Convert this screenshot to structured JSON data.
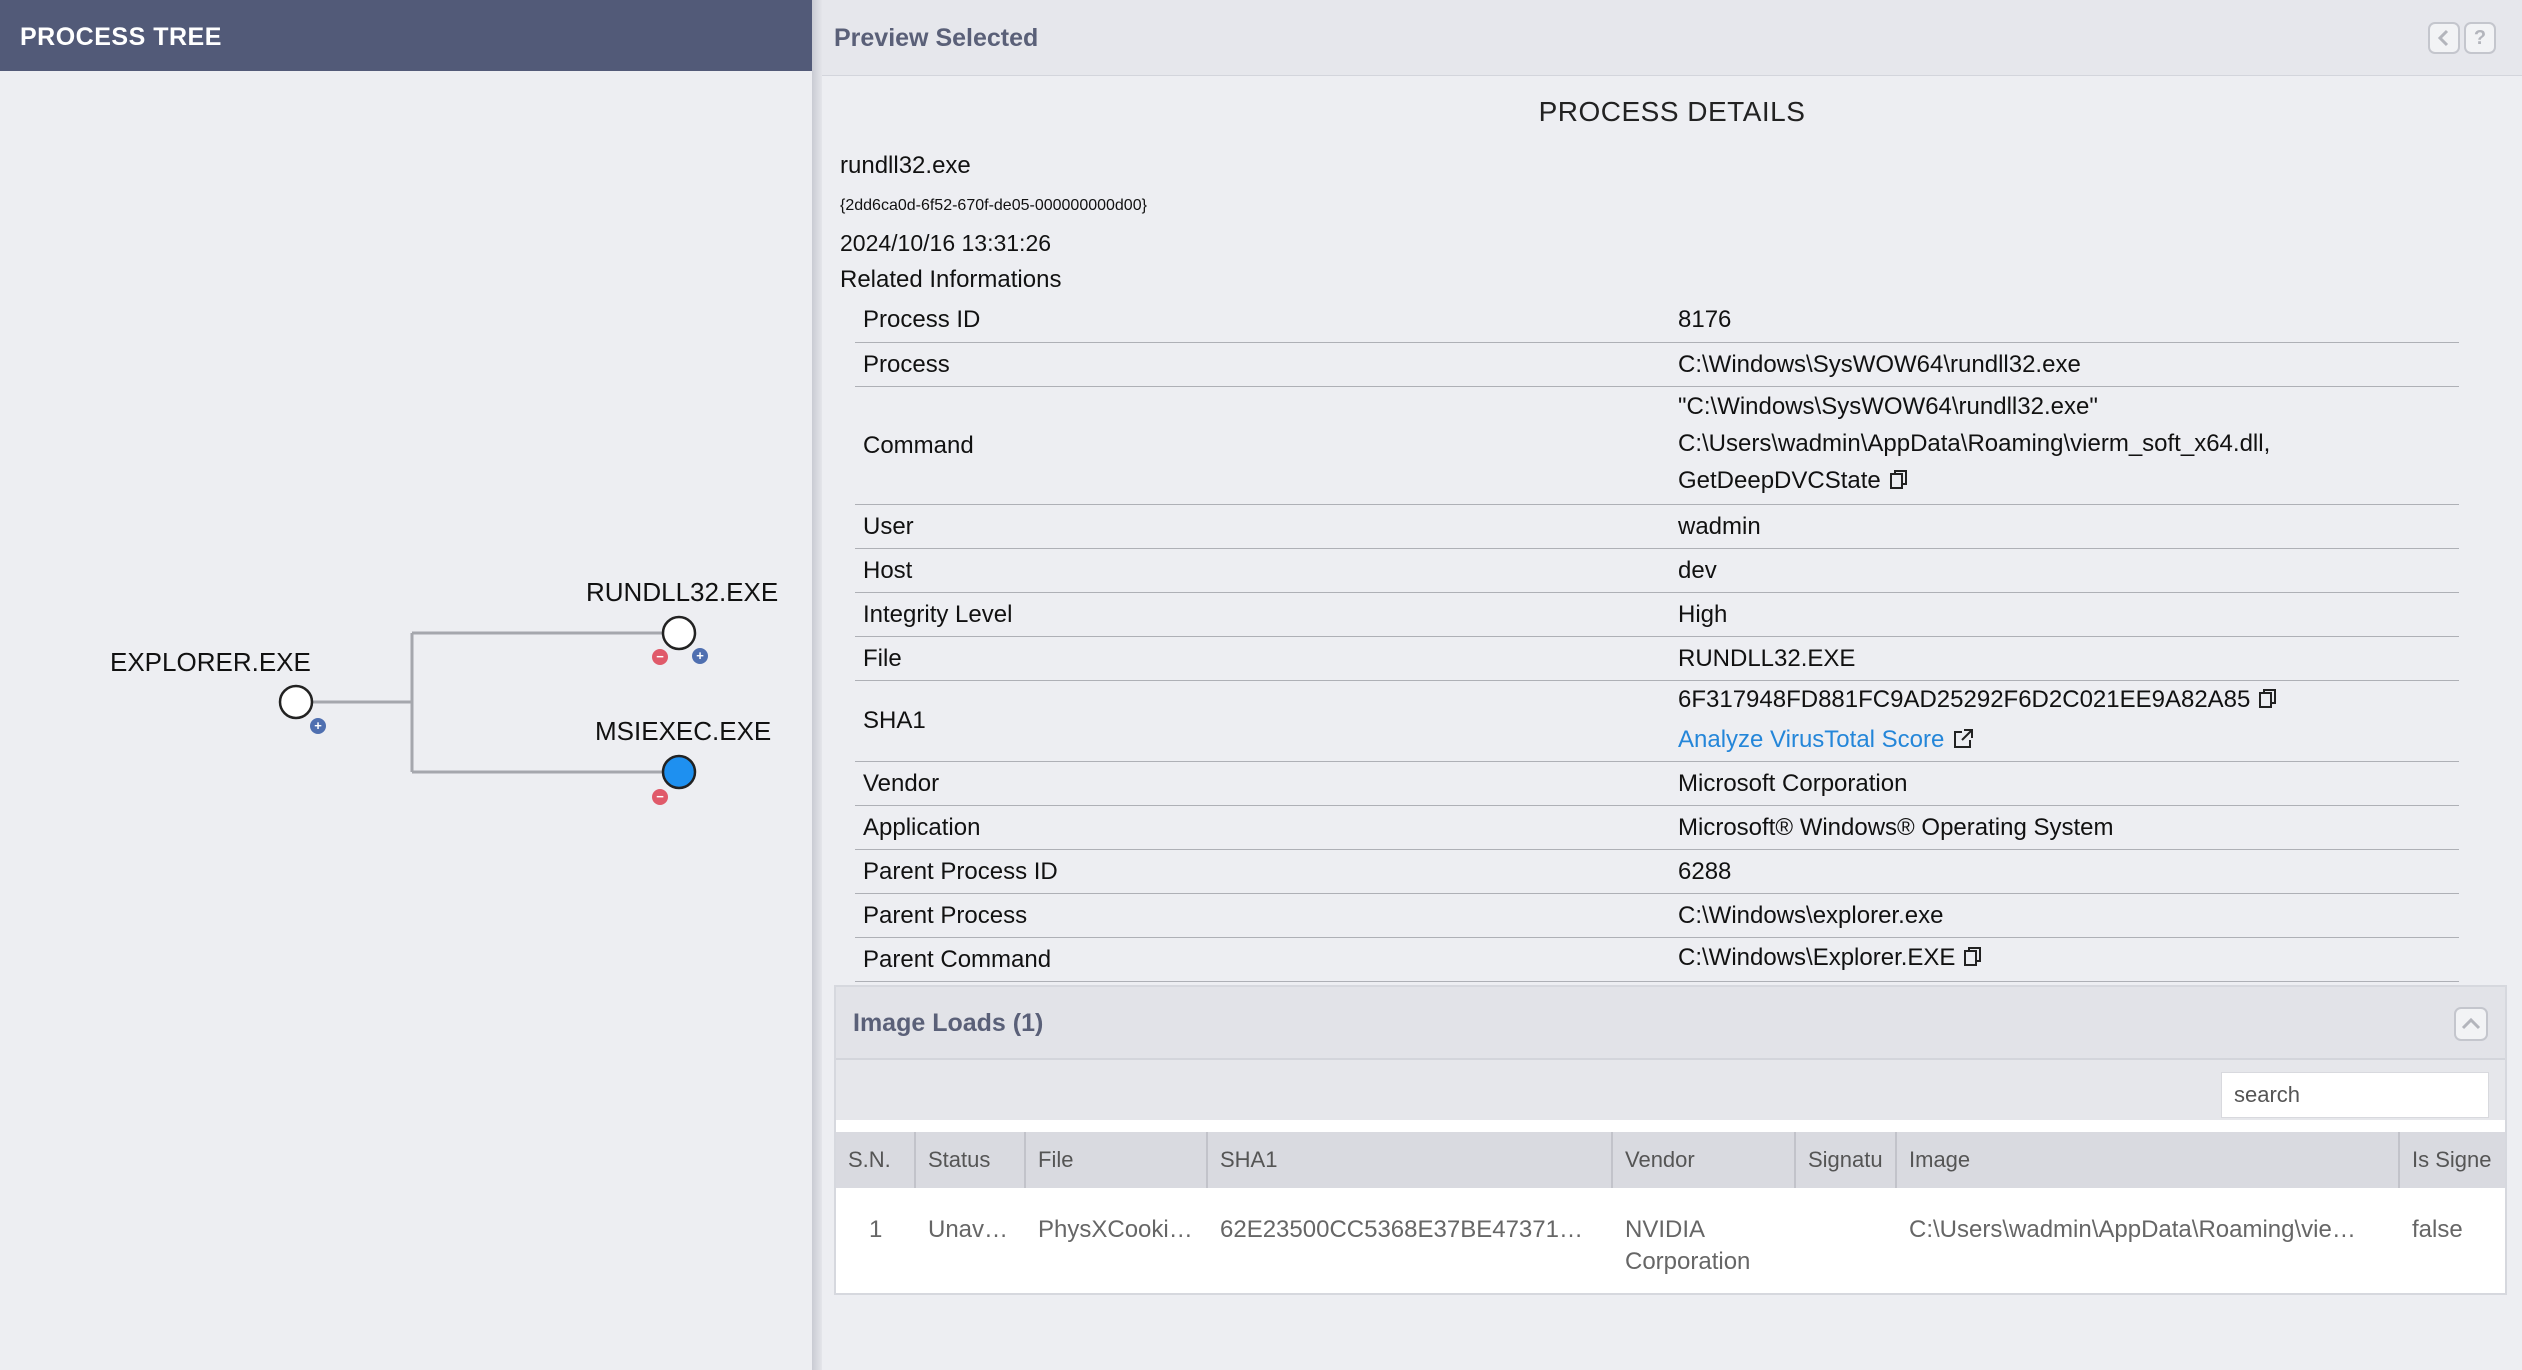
{
  "process_tree": {
    "title": "PROCESS TREE",
    "nodes": {
      "explorer": "EXPLORER.EXE",
      "rundll32": "RUNDLL32.EXE",
      "msiexec": "MSIEXEC.EXE"
    },
    "colors": {
      "selected_node": "#1e90f0",
      "expand": "#4f6fb0",
      "collapse": "#e05a6a"
    }
  },
  "preview": {
    "title": "Preview Selected",
    "back_icon": "chevron-left-icon",
    "help_icon": "help-icon"
  },
  "details": {
    "title": "PROCESS DETAILS",
    "process_name": "rundll32.exe",
    "guid": "{2dd6ca0d-6f52-670f-de05-000000000d00}",
    "timestamp": "2024/10/16 13:31:26",
    "related_title": "Related Informations",
    "rows": [
      {
        "key": "Process ID",
        "value": "8176"
      },
      {
        "key": "Process",
        "value": "C:\\Windows\\SysWOW64\\rundll32.exe"
      },
      {
        "key": "Command",
        "value_lines": [
          "\"C:\\Windows\\SysWOW64\\rundll32.exe\"",
          "C:\\Users\\wadmin\\AppData\\Roaming\\vierm_soft_x64.dll,",
          "GetDeepDVCState"
        ]
      },
      {
        "key": "User",
        "value": "wadmin"
      },
      {
        "key": "Host",
        "value": "dev"
      },
      {
        "key": "Integrity Level",
        "value": "High"
      },
      {
        "key": "File",
        "value": "RUNDLL32.EXE"
      },
      {
        "key": "SHA1",
        "value": "6F317948FD881FC9AD25292F6D2C021EE9A82A85",
        "link": "Analyze VirusTotal Score"
      },
      {
        "key": "Vendor",
        "value": "Microsoft Corporation"
      },
      {
        "key": "Application",
        "value": "Microsoft® Windows® Operating System"
      },
      {
        "key": "Parent Process ID",
        "value": "6288"
      },
      {
        "key": "Parent Process",
        "value": "C:\\Windows\\explorer.exe"
      },
      {
        "key": "Parent Command",
        "value": "C:\\Windows\\Explorer.EXE"
      }
    ],
    "link_color": "#2486d9"
  },
  "image_loads": {
    "title": "Image Loads (1)",
    "search_placeholder": "search",
    "columns": [
      "S.N.",
      "Status",
      "File",
      "SHA1",
      "Vendor",
      "Signatu",
      "Image",
      "Is Signe"
    ],
    "rows": [
      {
        "sn": "1",
        "status": "Unav…",
        "file": "PhysXCooki…",
        "sha1": "62E23500CC5368E37BE47371…",
        "vendor": "NVIDIA Corporation",
        "signature": "",
        "image": "C:\\Users\\wadmin\\AppData\\Roaming\\vie…",
        "is_signed": "false"
      }
    ]
  }
}
